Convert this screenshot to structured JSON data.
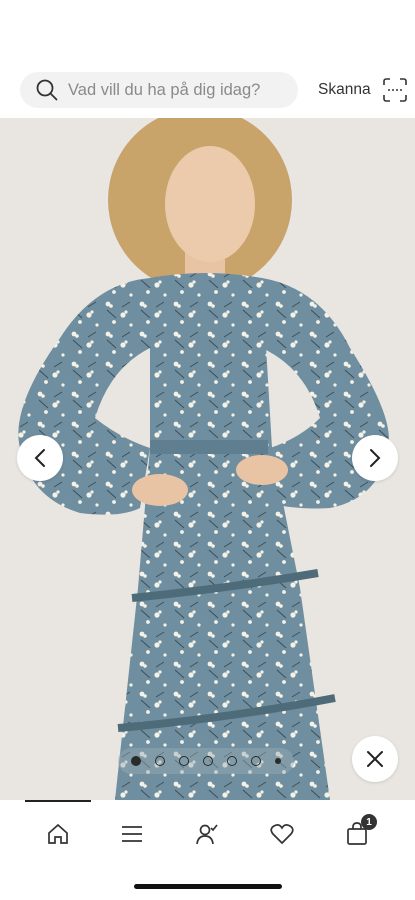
{
  "search": {
    "placeholder": "Vad vill du ha på dig idag?",
    "icon": "search-icon"
  },
  "scan": {
    "label": "Skanna",
    "icon": "scan-icon"
  },
  "product_image": {
    "alt": "",
    "gallery": {
      "total": 7,
      "active_index": 0
    }
  },
  "controls": {
    "prev_icon": "chevron-left-icon",
    "next_icon": "chevron-right-icon",
    "close_icon": "close-icon"
  },
  "bottom_nav": {
    "items": [
      {
        "name": "home",
        "icon": "home-icon"
      },
      {
        "name": "menu",
        "icon": "menu-icon"
      },
      {
        "name": "account",
        "icon": "account-icon"
      },
      {
        "name": "wishlist",
        "icon": "heart-icon"
      },
      {
        "name": "cart",
        "icon": "bag-icon"
      }
    ],
    "cart_count": "1"
  },
  "colors": {
    "dress": "#6f8ea0",
    "background": "#e9e6e1",
    "accent": "#222222"
  }
}
